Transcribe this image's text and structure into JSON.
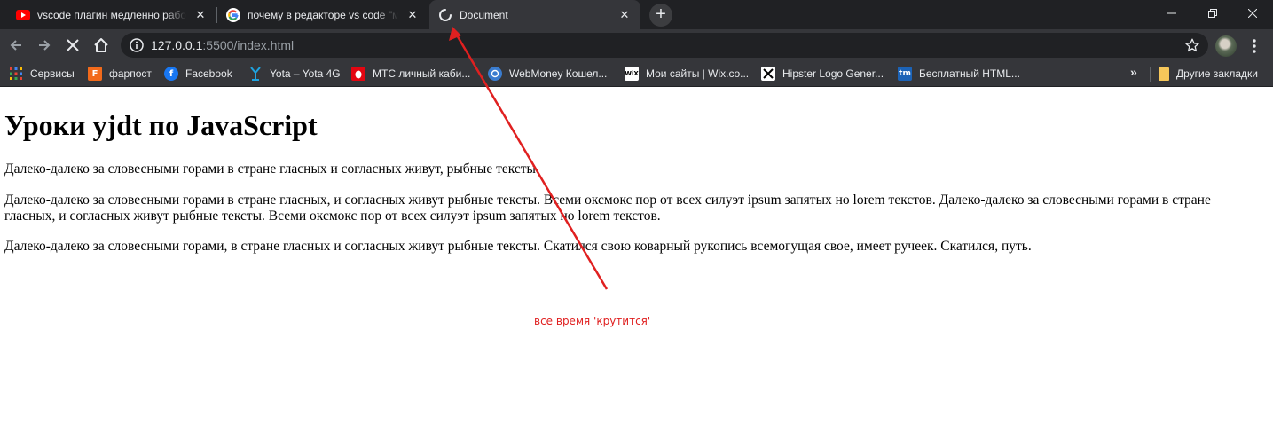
{
  "tabs": [
    {
      "title": "vscode плагин медленно работает",
      "favicon": "youtube-icon"
    },
    {
      "title": "почему в редакторе vs code \"медленно",
      "favicon": "google-icon"
    },
    {
      "title": "Document",
      "favicon": "loading-spinner-icon",
      "active": true
    }
  ],
  "address_bar": {
    "host": "127.0.0.1",
    "path": ":5500/index.html"
  },
  "bookmarks": [
    {
      "label": "Сервисы",
      "icon": "apps-grid-icon"
    },
    {
      "label": "фарпост",
      "icon": "farpost-icon",
      "color": "#f26a1b",
      "letter": "F"
    },
    {
      "label": "Facebook",
      "icon": "facebook-icon",
      "color": "#1877f2",
      "letter": "f"
    },
    {
      "label": "Yota – Yota 4G",
      "icon": "yota-icon",
      "color": "#1fa3e0"
    },
    {
      "label": "МТС личный каби...",
      "icon": "mts-icon",
      "color": "#e30611"
    },
    {
      "label": "WebMoney Кошел...",
      "icon": "webmoney-icon",
      "color": "#3a7ccf"
    },
    {
      "label": "Мои сайты | Wix.co...",
      "icon": "wix-icon",
      "color": "#ffffff",
      "letter": "WiX"
    },
    {
      "label": "Hipster Logo Gener...",
      "icon": "hipster-logo-icon",
      "color": "#ffffff"
    },
    {
      "label": "Бесплатный HTML...",
      "icon": "tm-icon",
      "color": "#1c63b7",
      "letter": "tm"
    }
  ],
  "other_bookmarks": "Другие закладки",
  "page": {
    "heading": "Уроки yjdt по JavaScript",
    "paragraphs": [
      "Далеко-далеко за словесными горами в стране гласных и согласных живут, рыбные тексты.",
      "Далеко-далеко за словесными горами в стране гласных, и согласных живут рыбные тексты. Всеми оксмокс пор от всех силуэт ipsum запятых но lorem текстов. Далеко-далеко за словесными горами в стране гласных, и согласных живут рыбные тексты. Всеми оксмокс пор от всех силуэт ipsum запятых но lorem текстов.",
      "Далеко-далеко за словесными горами, в стране гласных и согласных живут рыбные тексты. Скатился свою коварный рукопись всемогущая свое, имеет ручеек. Скатился, путь."
    ]
  },
  "annotation": {
    "text": "все время 'крутится'",
    "color": "#e02020"
  },
  "colors": {
    "tabstrip": "#202124",
    "toolbar": "#35363a",
    "text_light": "#e8eaed",
    "url_dim": "#9aa0a6"
  }
}
